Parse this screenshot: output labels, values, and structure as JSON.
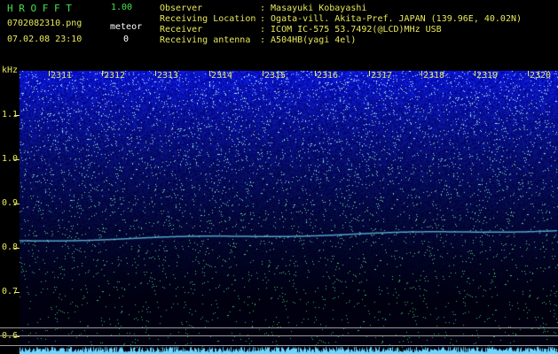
{
  "header": {
    "app_title": "H R O F F T",
    "version": "1.00",
    "filename": "0702082310.png",
    "datetime": "07.02.08 23:10",
    "meteor_label": "meteor",
    "meteor_count": "0",
    "info": [
      {
        "label": "Observer",
        "value": ": Masayuki Kobayashi"
      },
      {
        "label": "Receiving Location",
        "value": ": Ogata-vill. Akita-Pref. JAPAN (139.96E, 40.02N)"
      },
      {
        "label": "Receiver",
        "value": ": ICOM IC-575 53.7492(@LCD)MHz USB"
      },
      {
        "label": "Receiving antenna",
        "value": ": A504HB(yagi 4el)"
      }
    ]
  },
  "yaxis": {
    "unit": "kHz",
    "ticks": [
      "1.1",
      "1.0",
      "0.9",
      "0.8",
      "0.7",
      "0.6"
    ]
  },
  "xaxis": {
    "ticks": [
      "2311",
      "2312",
      "2313",
      "2314",
      "2315",
      "2316",
      "2317",
      "2318",
      "2319",
      "2320"
    ]
  },
  "colors": {
    "label_yellow": "#e8e85a",
    "title_green": "#43e24a",
    "signal_cyan": "#6fd7ff",
    "spectrum_blue": "#1c2bd6"
  }
}
